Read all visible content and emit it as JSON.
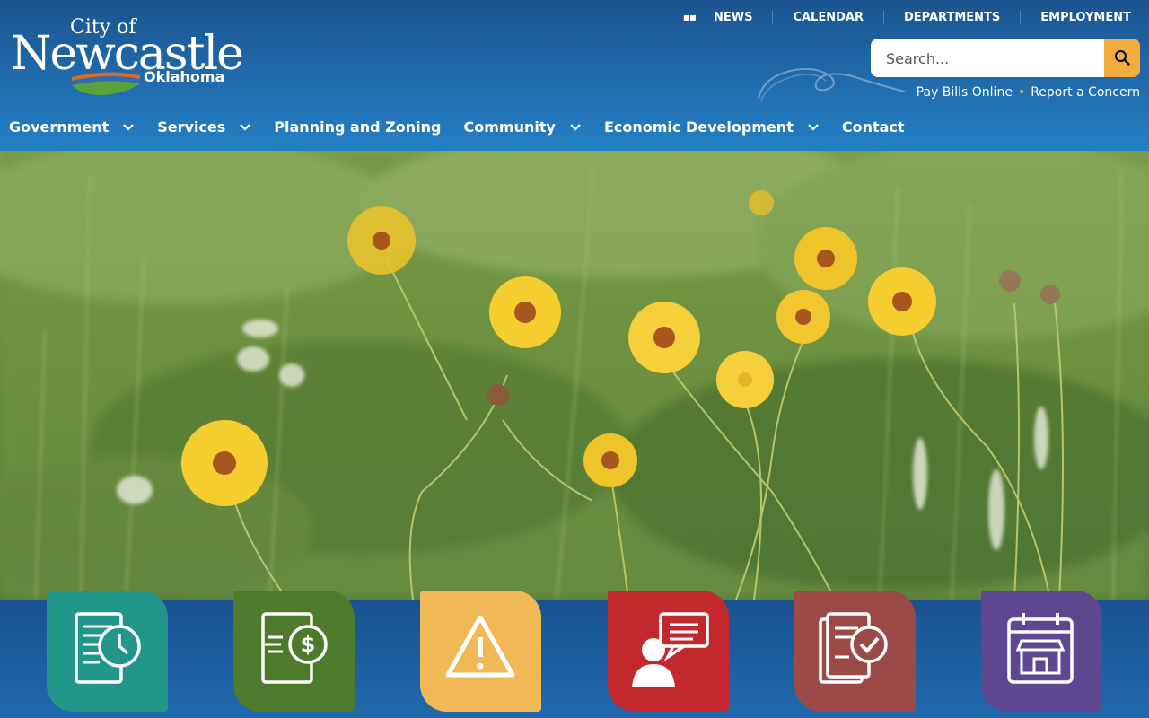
{
  "logo": {
    "city_of": "City of",
    "name": "Newcastle",
    "state": "Oklahoma"
  },
  "top_nav": {
    "items": [
      "NEWS",
      "CALENDAR",
      "DEPARTMENTS",
      "EMPLOYMENT"
    ]
  },
  "search": {
    "placeholder": "Search..."
  },
  "quick_links": {
    "pay_bills": "Pay Bills Online",
    "report": "Report a Concern"
  },
  "main_nav": {
    "items": [
      {
        "label": "Government",
        "dropdown": true
      },
      {
        "label": "Services",
        "dropdown": true
      },
      {
        "label": "Planning and Zoning",
        "dropdown": false
      },
      {
        "label": "Community",
        "dropdown": true
      },
      {
        "label": "Economic Development",
        "dropdown": true
      },
      {
        "label": "Contact",
        "dropdown": false
      }
    ]
  },
  "quick_tiles": [
    {
      "icon": "document-clock-icon",
      "color": "#23968c"
    },
    {
      "icon": "document-dollar-icon",
      "color": "#4d7a2b"
    },
    {
      "icon": "warning-icon",
      "color": "#f0b955"
    },
    {
      "icon": "person-speech-icon",
      "color": "#c4282f"
    },
    {
      "icon": "document-check-icon",
      "color": "#9c4a48"
    },
    {
      "icon": "calendar-store-icon",
      "color": "#5e4690"
    }
  ],
  "colors": {
    "header": "#1f66a8",
    "accent": "#f2ad3e"
  }
}
